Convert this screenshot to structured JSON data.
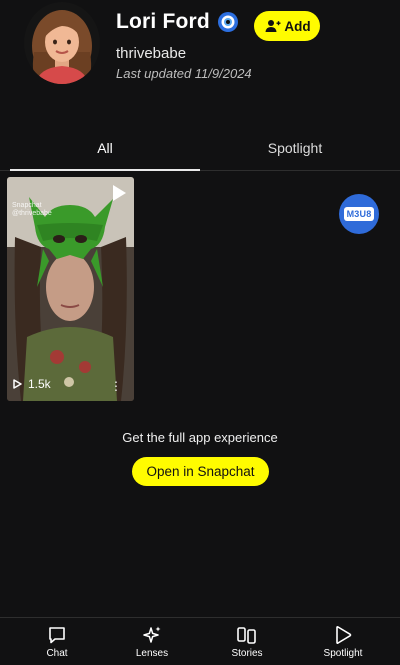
{
  "profile": {
    "display_name": "Lori Ford",
    "username": "thrivebabe",
    "last_updated": "Last updated 11/9/2024",
    "add_label": "Add",
    "avatar_icon": "bitmoji-avatar",
    "verified_icon": "verified-badge-icon"
  },
  "tabs": [
    {
      "label": "All",
      "active": true
    },
    {
      "label": "Spotlight",
      "active": false
    }
  ],
  "tile": {
    "watermark_brand": "Snapchat",
    "watermark_user": "@thrivebabe",
    "views": "1.5k"
  },
  "m3u8_label": "M3U8",
  "promo": {
    "text": "Get the full app experience",
    "button": "Open in Snapchat"
  },
  "nav": [
    {
      "label": "Chat",
      "icon": "chat-icon"
    },
    {
      "label": "Lenses",
      "icon": "lenses-icon"
    },
    {
      "label": "Stories",
      "icon": "stories-icon"
    },
    {
      "label": "Spotlight",
      "icon": "spotlight-icon"
    }
  ],
  "colors": {
    "background": "#111112",
    "accent_yellow": "#fffc00",
    "m3u8_blue": "#2f6bd9"
  }
}
